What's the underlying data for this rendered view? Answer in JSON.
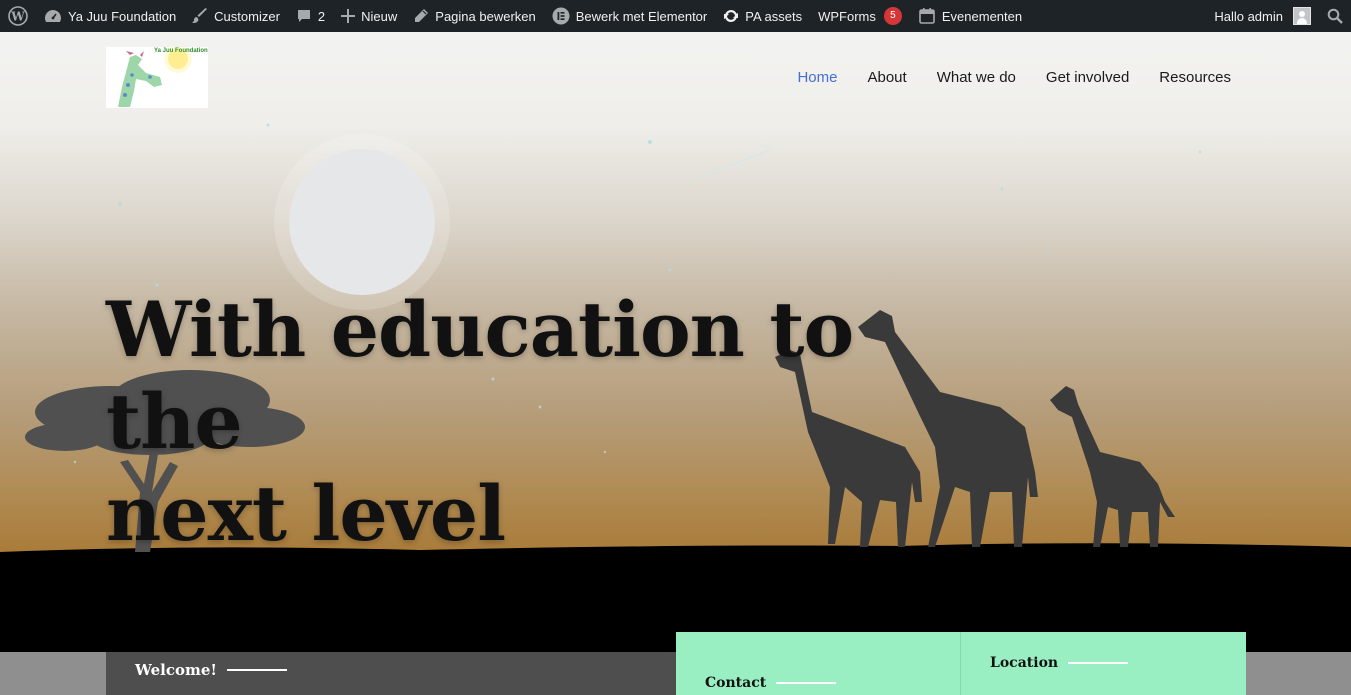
{
  "adminbar": {
    "site_name": "Ya Juu Foundation",
    "customizer": "Customizer",
    "comments_count": "2",
    "new": "Nieuw",
    "edit_page": "Pagina bewerken",
    "elementor": "Bewerk met Elementor",
    "pa_assets": "PA assets",
    "wpforms": "WPForms",
    "wpforms_count": "5",
    "events": "Evenementen",
    "greeting": "Hallo admin"
  },
  "header": {
    "logo_text": "Ya Juu Foundation",
    "nav": [
      "Home",
      "About",
      "What we do",
      "Get involved",
      "Resources"
    ],
    "active_nav": "Home"
  },
  "hero": {
    "headline_line1": "With education to the",
    "headline_line2": "next level"
  },
  "sections": {
    "welcome": "Welcome!",
    "contact": "Contact",
    "location": "Location"
  },
  "colors": {
    "adminbar": "#1d2327",
    "nav_active": "#4470d4",
    "contact_box": "#99efc2",
    "badge": "#d63638"
  }
}
